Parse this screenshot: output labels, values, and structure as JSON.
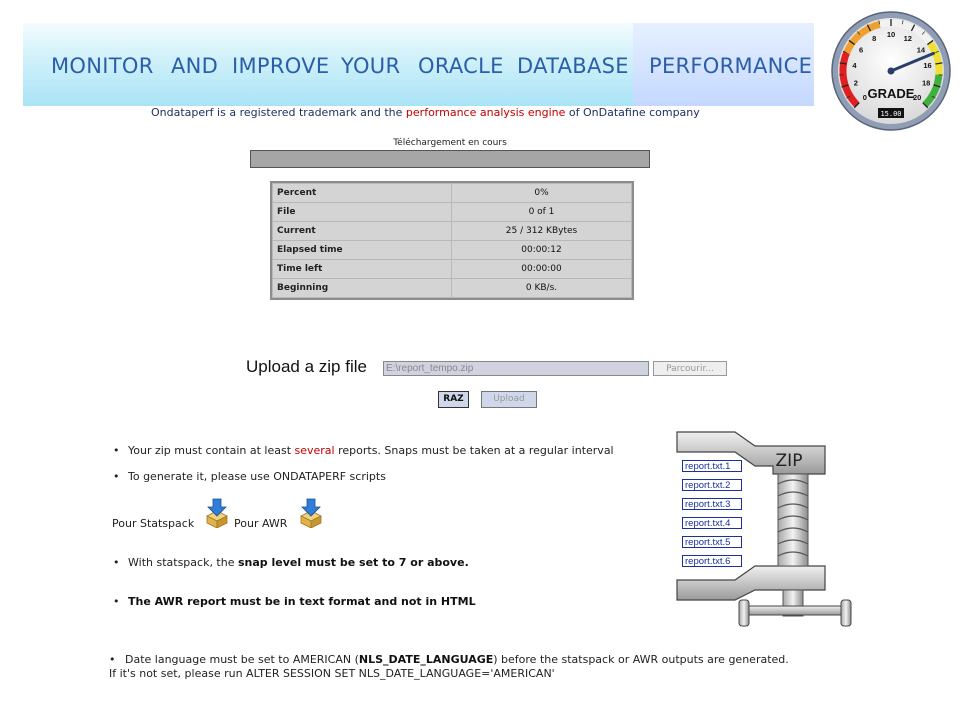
{
  "banner": {
    "words": [
      "MONITOR",
      "AND",
      "IMPROVE",
      "YOUR",
      "ORACLE",
      "DATABASE",
      "PERFORMANCE"
    ],
    "tagline_pre": "Ondataperf is a registered trademark and the ",
    "tagline_red": "performance analysis engine",
    "tagline_post": " of OnDatafine company"
  },
  "gauge": {
    "title": "GRADE",
    "ticks": [
      "0",
      "2",
      "4",
      "6",
      "8",
      "10",
      "12",
      "14",
      "16",
      "18",
      "20"
    ],
    "value_text": "15.00",
    "value": 15
  },
  "download": {
    "status": "Téléchargement en cours",
    "progress": 0
  },
  "stats": [
    {
      "key": "Percent",
      "value": "0%"
    },
    {
      "key": "File",
      "value": "0 of 1"
    },
    {
      "key": "Current",
      "value": "25 / 312 KBytes"
    },
    {
      "key": "Elapsed time",
      "value": "00:00:12"
    },
    {
      "key": "Time left",
      "value": "00:00:00"
    },
    {
      "key": "Beginning",
      "value": "0 KB/s."
    }
  ],
  "upload": {
    "label": "Upload a zip file",
    "file_value": "E:\\report_tempo.zip",
    "browse_label": "Parcourir...",
    "raz_label": "RAZ",
    "upload_label": "Upload"
  },
  "notes": {
    "b1_pre": "Your zip must contain at least ",
    "b1_red": "several",
    "b1_post": " reports. Snaps must be taken at a regular interval",
    "b2": "To generate it, please use ONDATAPERF scripts",
    "statspack_label": "Pour Statspack",
    "awr_label": "Pour AWR",
    "b3_pre": "With statspack, the ",
    "b3_bold": "snap level must be set to 7 or above.",
    "b4": "The AWR report must be in text format and not in HTML",
    "b5_pre": "Date language must be set to AMERICAN (",
    "b5_bold": "NLS_DATE_LANGUAGE",
    "b5_post": ") before the statspack or AWR outputs are generated.",
    "b5_line2": "If it's not set, please run ALTER SESSION SET NLS_DATE_LANGUAGE='AMERICAN'"
  },
  "zip_graphic": {
    "label": "ZIP",
    "files": [
      "report.txt.1",
      "report.txt.2",
      "report.txt.3",
      "report.txt.4",
      "report.txt.5",
      "report.txt.6"
    ]
  }
}
